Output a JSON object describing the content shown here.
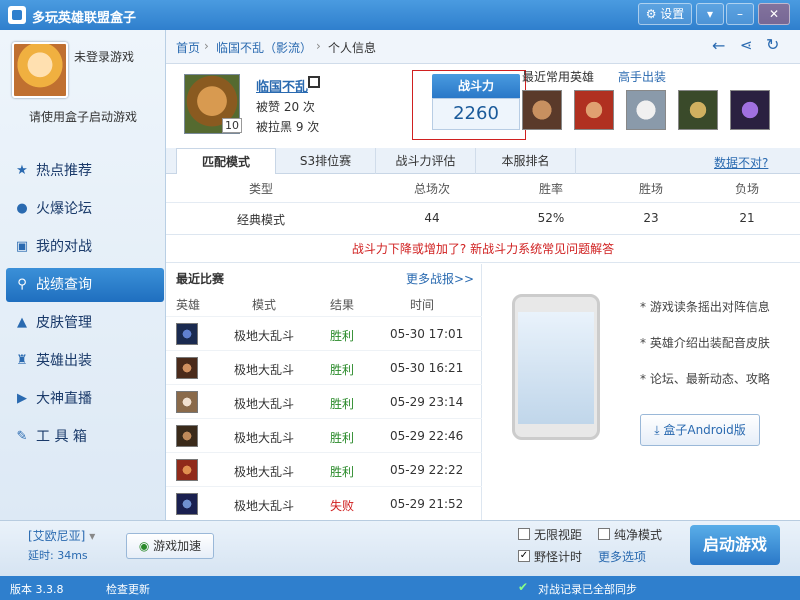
{
  "window": {
    "title": "多玩英雄联盟盒子",
    "settings_label": "设置",
    "min_icon": "minimize-icon",
    "close_icon": "close-icon"
  },
  "sidebar": {
    "user_status": "未登录游戏",
    "hint": "请使用盒子启动游戏",
    "items": [
      {
        "label": "热点推荐",
        "icon": "star-icon"
      },
      {
        "label": "火爆论坛",
        "icon": "chat-icon"
      },
      {
        "label": "我的对战",
        "icon": "battle-icon"
      },
      {
        "label": "战绩查询",
        "icon": "search-icon"
      },
      {
        "label": "皮肤管理",
        "icon": "hat-icon"
      },
      {
        "label": "英雄出装",
        "icon": "armor-icon"
      },
      {
        "label": "大神直播",
        "icon": "play-icon"
      },
      {
        "label": "工 具 箱",
        "icon": "wrench-icon"
      }
    ],
    "active_index": 3
  },
  "breadcrumb": {
    "home": "首页",
    "sep": "›",
    "server": "临国不乱（影流）",
    "page": "个人信息"
  },
  "profile": {
    "name": "临国不乱",
    "likes": "被赞 20 次",
    "blocked": "被拉黑 9 次",
    "level": "10"
  },
  "power": {
    "label": "战斗力",
    "value": "2260"
  },
  "recent_heroes": {
    "label": "最近常用英雄",
    "link": "高手出装"
  },
  "tabs": [
    "匹配模式",
    "S3排位赛",
    "战斗力评估",
    "本服排名"
  ],
  "data_wrong": "数据不对?",
  "stats": {
    "headers": [
      "类型",
      "总场次",
      "胜率",
      "胜场",
      "负场"
    ],
    "row": [
      "经典模式",
      "44",
      "52%",
      "23",
      "21"
    ]
  },
  "notice": "战斗力下降或增加了? 新战斗力系统常见问题解答",
  "matches": {
    "title": "最近比赛",
    "more": "更多战报>>",
    "headers": [
      "英雄",
      "模式",
      "结果",
      "时间"
    ],
    "rows": [
      {
        "mode": "极地大乱斗",
        "result": "胜利",
        "time": "05-30 17:01"
      },
      {
        "mode": "极地大乱斗",
        "result": "胜利",
        "time": "05-30 16:21"
      },
      {
        "mode": "极地大乱斗",
        "result": "胜利",
        "time": "05-29 23:14"
      },
      {
        "mode": "极地大乱斗",
        "result": "胜利",
        "time": "05-29 22:46"
      },
      {
        "mode": "极地大乱斗",
        "result": "胜利",
        "time": "05-29 22:22"
      },
      {
        "mode": "极地大乱斗",
        "result": "失败",
        "time": "05-29 21:52"
      }
    ]
  },
  "promo": {
    "features": [
      "* 游戏读条摇出对阵信息",
      "* 英雄介绍出装配音皮肤",
      "* 论坛、最新动态、攻略"
    ],
    "android": "盒子Android版"
  },
  "bottom": {
    "server": "[艾欧尼亚]",
    "latency": "延时: 34ms",
    "accel": "游戏加速",
    "opt1": "无限视距",
    "opt2": "纯净模式",
    "opt3": "野怪计时",
    "opt4": "更多选项",
    "launch": "启动游戏"
  },
  "status": {
    "version": "版本 3.3.8",
    "update": "检查更新",
    "sync": "对战记录已全部同步"
  }
}
